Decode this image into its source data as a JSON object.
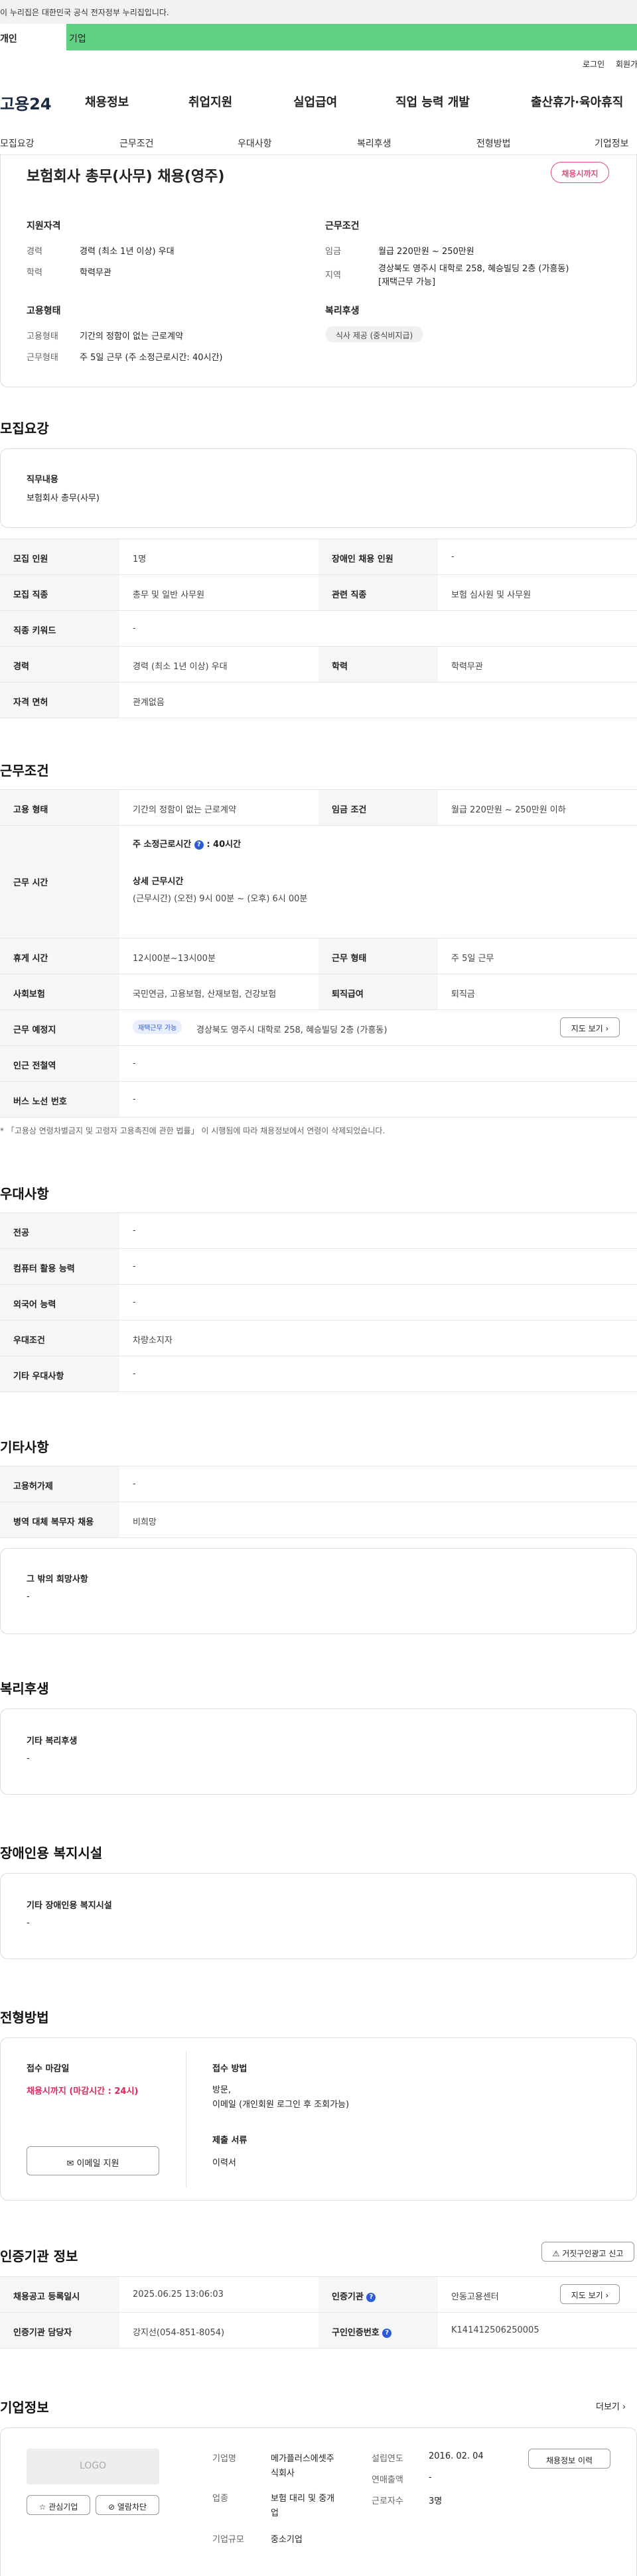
{
  "gov_banner": "이 누리집은 대한민국 공식 전자정부 누리집입니다.",
  "tabs": {
    "personal": "개인",
    "company": "기업"
  },
  "utility": {
    "login": "로그인",
    "signup": "회원가입"
  },
  "logo": "고용24",
  "gnb": [
    "채용정보",
    "취업지원",
    "실업급여",
    "직업 능력 개발",
    "출산휴가·육아휴직"
  ],
  "subnav": [
    "모집요강",
    "근무조건",
    "우대사항",
    "복리후생",
    "전형방법",
    "기업정보"
  ],
  "summary": {
    "title": "보험회사 총무(사무) 채용(영주)",
    "badge": "채용시까지",
    "qual_heading": "지원자격",
    "qual": [
      {
        "k": "경력",
        "v": "경력 (최소 1년 이상) 우대"
      },
      {
        "k": "학력",
        "v": "학력무관"
      }
    ],
    "cond_heading": "근무조건",
    "cond_wage_k": "임금",
    "cond_wage_v": "월급 220만원 ~ 250만원",
    "cond_area_k": "지역",
    "cond_area_v1": "경상북도 영주시 대학로 258, 혜승빌딩 2층 (가흥동)",
    "cond_area_v2": "[재택근무 가능]",
    "emp_heading": "고용형태",
    "emp": [
      {
        "k": "고용형태",
        "v": "기간의 정함이 없는 근로계약"
      },
      {
        "k": "근무형태",
        "v": "주 5일 근무 (주 소정근로시간: 40시간)"
      }
    ],
    "welfare_heading": "복리후생",
    "welfare_pill": "식사 제공 (중식비지급)"
  },
  "recruit": {
    "heading": "모집요강",
    "duty_label": "직무내용",
    "duty_value": "보험회사 총무(사무)",
    "rows": [
      {
        "k1": "모집 인원",
        "v1": "1명",
        "k2": "장애인 채용 인원",
        "v2": "-"
      },
      {
        "k1": "모집 직종",
        "v1": "총무 및 일반 사무원",
        "k2": "관련 직종",
        "v2": "보험 심사원 및 사무원"
      },
      {
        "k1": "직종 키워드",
        "v1": "-"
      },
      {
        "k1": "경력",
        "v1": "경력 (최소 1년 이상) 우대",
        "k2": "학력",
        "v2": "학력무관"
      },
      {
        "k1": "자격 면허",
        "v1": "관계없음"
      }
    ]
  },
  "conditions": {
    "heading": "근무조건",
    "emp_k": "고용 형태",
    "emp_v": "기간의 정함이 없는 근로계약",
    "wage_k": "임금 조건",
    "wage_v": "월급 220만원 ~ 250만원 이하",
    "time_k": "근무 시간",
    "time_weekly": "주 소정근로시간",
    "time_weekly_v": ": 40시간",
    "time_detail_label": "상세 근무시간",
    "time_detail_v": "(근무시간) (오전) 9시 00분 ~ (오후) 6시 00분",
    "break_k": "휴게 시간",
    "break_v": "12시00분~13시00분",
    "form_k": "근무 형태",
    "form_v": "주 5일 근무",
    "ins_k": "사회보험",
    "ins_v": "국민연금, 고용보험, 산재보험, 건강보험",
    "sev_k": "퇴직급여",
    "sev_v": "퇴직금",
    "place_k": "근무 예정지",
    "place_tag": "재택근무 가능",
    "place_v": "경상북도 영주시 대학로 258, 혜승빌딩 2층 (가흥동)",
    "map_btn": "지도 보기",
    "station_k": "인근 전철역",
    "station_v": "-",
    "bus_k": "버스 노선 번호",
    "bus_v": "-",
    "note": "「고용상 연령차별금지 및 고령자 고용촉진에 관한 법률」 이 시행됨에 따라 채용정보에서 연령이 삭제되었습니다."
  },
  "preference": {
    "heading": "우대사항",
    "rows": [
      {
        "k": "전공",
        "v": "-"
      },
      {
        "k": "컴퓨터 활용 능력",
        "v": "-"
      },
      {
        "k": "외국어 능력",
        "v": "-"
      },
      {
        "k": "우대조건",
        "v": "차량소지자"
      },
      {
        "k": "기타 우대사항",
        "v": "-"
      }
    ]
  },
  "etc": {
    "heading": "기타사항",
    "rows": [
      {
        "k": "고용허가제",
        "v": "-"
      },
      {
        "k": "병역 대체 복무자 채용",
        "v": "비희망"
      }
    ],
    "hope_label": "그 밖의 희망사항",
    "hope_value": "-"
  },
  "benefits": {
    "heading": "복리후생",
    "label": "기타 복리후생",
    "value": "-"
  },
  "disabled": {
    "heading": "장애인용 복지시설",
    "label": "기타 장애인용 복지시설",
    "value": "-"
  },
  "selection": {
    "heading": "전형방법",
    "deadline_label": "접수 마감일",
    "deadline_value": "채용시까지 (마감시간 : 24시)",
    "method_label": "접수 방법",
    "method_v1": "방문,",
    "method_v2": "이메일 (개인회원 로그인 후 조회가능)",
    "docs_label": "제출 서류",
    "docs_value": "이력서",
    "email_btn": "이메일 지원"
  },
  "cert": {
    "heading": "인증기관 정보",
    "report_btn": "거짓구인광고 신고",
    "date_k": "채용공고 등록일시",
    "date_v": "2025.06.25 13:06:03",
    "org_k": "인증기관",
    "org_v": "안동고용센터",
    "map_btn": "지도 보기",
    "mgr_k": "인증기관 담당자",
    "mgr_v": "강지선(054-851-8054)",
    "no_k": "구인인증번호",
    "no_v": "K141412506250005"
  },
  "company": {
    "heading": "기업정보",
    "more": "더보기",
    "logo_text": "LOGO",
    "fav_btn": "관심기업",
    "block_btn": "열람차단",
    "name_k": "기업명",
    "name_v1": "메가플러스에셋주",
    "name_v2": "식회사",
    "biz_k": "업종",
    "biz_v1": "보험 대리 및 중개",
    "biz_v2": "업",
    "size_k": "기업규모",
    "size_v": "중소기업",
    "est_k": "설립연도",
    "est_v": "2016. 02. 04",
    "sales_k": "연매출액",
    "sales_v": "-",
    "emp_k": "근로자수",
    "emp_v": "3명",
    "history_btn": "채용정보 이력"
  }
}
